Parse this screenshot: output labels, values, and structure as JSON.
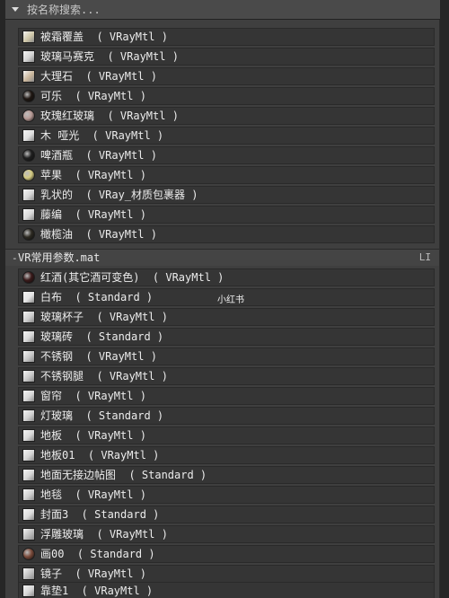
{
  "search": {
    "placeholder": "按名称搜索..."
  },
  "groups": [
    {
      "name": "",
      "items": [
        {
          "label": "被霜覆盖  ( VRayMtl )",
          "icon": "swatch-frost",
          "color": "#cfc7a8"
        },
        {
          "label": "玻璃马赛克  ( VRayMtl )",
          "icon": "swatch-glass-mosaic",
          "color": "#d4d4d4"
        },
        {
          "label": "大理石  ( VRayMtl )",
          "icon": "swatch-marble",
          "color": "#c9b59a"
        },
        {
          "label": "可乐  ( VRayMtl )",
          "icon": "sphere-cola",
          "color": "#1f1712"
        },
        {
          "label": "玫瑰红玻璃  ( VRayMtl )",
          "icon": "swatch-rose-glass",
          "color": "#b79a95"
        },
        {
          "label": "木 哑光  ( VRayMtl )",
          "icon": "swatch-wood-matte",
          "color": "#e0e0e0"
        },
        {
          "label": "啤酒瓶  ( VRayMtl )",
          "icon": "sphere-beer-bottle",
          "color": "#202020"
        },
        {
          "label": "苹果  ( VRayMtl )",
          "icon": "swatch-apple",
          "color": "#d4cb82"
        },
        {
          "label": "乳状的  ( VRay_材质包裹器 )",
          "icon": "swatch-milky",
          "color": "#d6d6d6"
        },
        {
          "label": "藤编  ( VRayMtl )",
          "icon": "swatch-rattan",
          "color": "#dadada"
        },
        {
          "label": "橄榄油  ( VRayMtl )",
          "icon": "sphere-olive-oil",
          "color": "#2d2a22"
        }
      ]
    },
    {
      "name": "VR常用参数.mat",
      "badge": "LI",
      "items": [
        {
          "label": "红酒(其它酒可变色)  ( VRayMtl )",
          "icon": "sphere-red-wine",
          "color": "#3a1a1a"
        },
        {
          "label": "白布  ( Standard )",
          "icon": "swatch-white-cloth",
          "color": "#e4e4e4"
        },
        {
          "label": "玻璃杯子  ( VRayMtl )",
          "icon": "swatch-glass-cup",
          "color": "#cfcfcf"
        },
        {
          "label": "玻璃砖  ( Standard )",
          "icon": "swatch-glass-brick",
          "color": "#d8d8d8"
        },
        {
          "label": "不锈钢  ( VRayMtl )",
          "icon": "swatch-stainless",
          "color": "#c7c7c7"
        },
        {
          "label": "不锈钢腿  ( VRayMtl )",
          "icon": "swatch-stainless-leg",
          "color": "#cacaca"
        },
        {
          "label": "窗帘  ( VRayMtl )",
          "icon": "swatch-curtain",
          "color": "#d8d8d8"
        },
        {
          "label": "灯玻璃  ( Standard )",
          "icon": "swatch-lamp-glass",
          "color": "#d2d2d2"
        },
        {
          "label": "地板  ( VRayMtl )",
          "icon": "swatch-floor",
          "color": "#d9d9d9"
        },
        {
          "label": "地板01  ( VRayMtl )",
          "icon": "swatch-floor-01",
          "color": "#d5d5d5"
        },
        {
          "label": "地面无接边帖图  ( Standard )",
          "icon": "swatch-ground",
          "color": "#d7d7d7"
        },
        {
          "label": "地毯  ( VRayMtl )",
          "icon": "swatch-carpet",
          "color": "#d0d0d0"
        },
        {
          "label": "封面3  ( Standard )",
          "icon": "swatch-cover3",
          "color": "#dcdcdc"
        },
        {
          "label": "浮雕玻璃  ( VRayMtl )",
          "icon": "swatch-relief-glass",
          "color": "#bdbdbd"
        },
        {
          "label": "画00  ( Standard )",
          "icon": "sphere-painting",
          "color": "#7a4a3a"
        },
        {
          "label": "镜子  ( VRayMtl )",
          "icon": "swatch-mirror",
          "color": "#bfbfbf"
        },
        {
          "label": "靠垫1  ( VRayMtl )",
          "icon": "swatch-cushion",
          "color": "#d6d6d6"
        }
      ]
    }
  ],
  "watermark": "小红书"
}
